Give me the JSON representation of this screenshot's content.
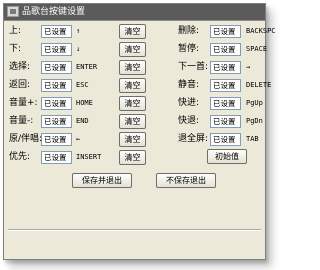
{
  "window": {
    "title": "品歌台按键设置"
  },
  "left_rows": [
    {
      "label": "上:",
      "value": "已设置",
      "key": "↑",
      "clear": "清空"
    },
    {
      "label": "下:",
      "value": "已设置",
      "key": "↓",
      "clear": "清空"
    },
    {
      "label": "选择:",
      "value": "已设置",
      "key": "ENTER",
      "clear": "清空"
    },
    {
      "label": "返回:",
      "value": "已设置",
      "key": "ESC",
      "clear": "清空"
    },
    {
      "label": "音量+:",
      "value": "已设置",
      "key": "HOME",
      "clear": "清空"
    },
    {
      "label": "音量-:",
      "value": "已设置",
      "key": "END",
      "clear": "清空"
    },
    {
      "label": "原/伴唱:",
      "value": "已设置",
      "key": "←",
      "clear": "清空"
    },
    {
      "label": "优先:",
      "value": "已设置",
      "key": "INSERT",
      "clear": "清空"
    }
  ],
  "right_rows": [
    {
      "label": "删除:",
      "value": "已设置",
      "key": "BACKSPC"
    },
    {
      "label": "暂停:",
      "value": "已设置",
      "key": "SPACE"
    },
    {
      "label": "下一首:",
      "value": "已设置",
      "key": "→"
    },
    {
      "label": "静音:",
      "value": "已设置",
      "key": "DELETE"
    },
    {
      "label": "快进:",
      "value": "已设置",
      "key": "PgUp"
    },
    {
      "label": "快退:",
      "value": "已设置",
      "key": "PgDn"
    },
    {
      "label": "退全屏:",
      "value": "已设置",
      "key": "TAB"
    }
  ],
  "buttons": {
    "init": "初始值",
    "save_exit": "保存并退出",
    "exit_no_save": "不保存退出"
  }
}
